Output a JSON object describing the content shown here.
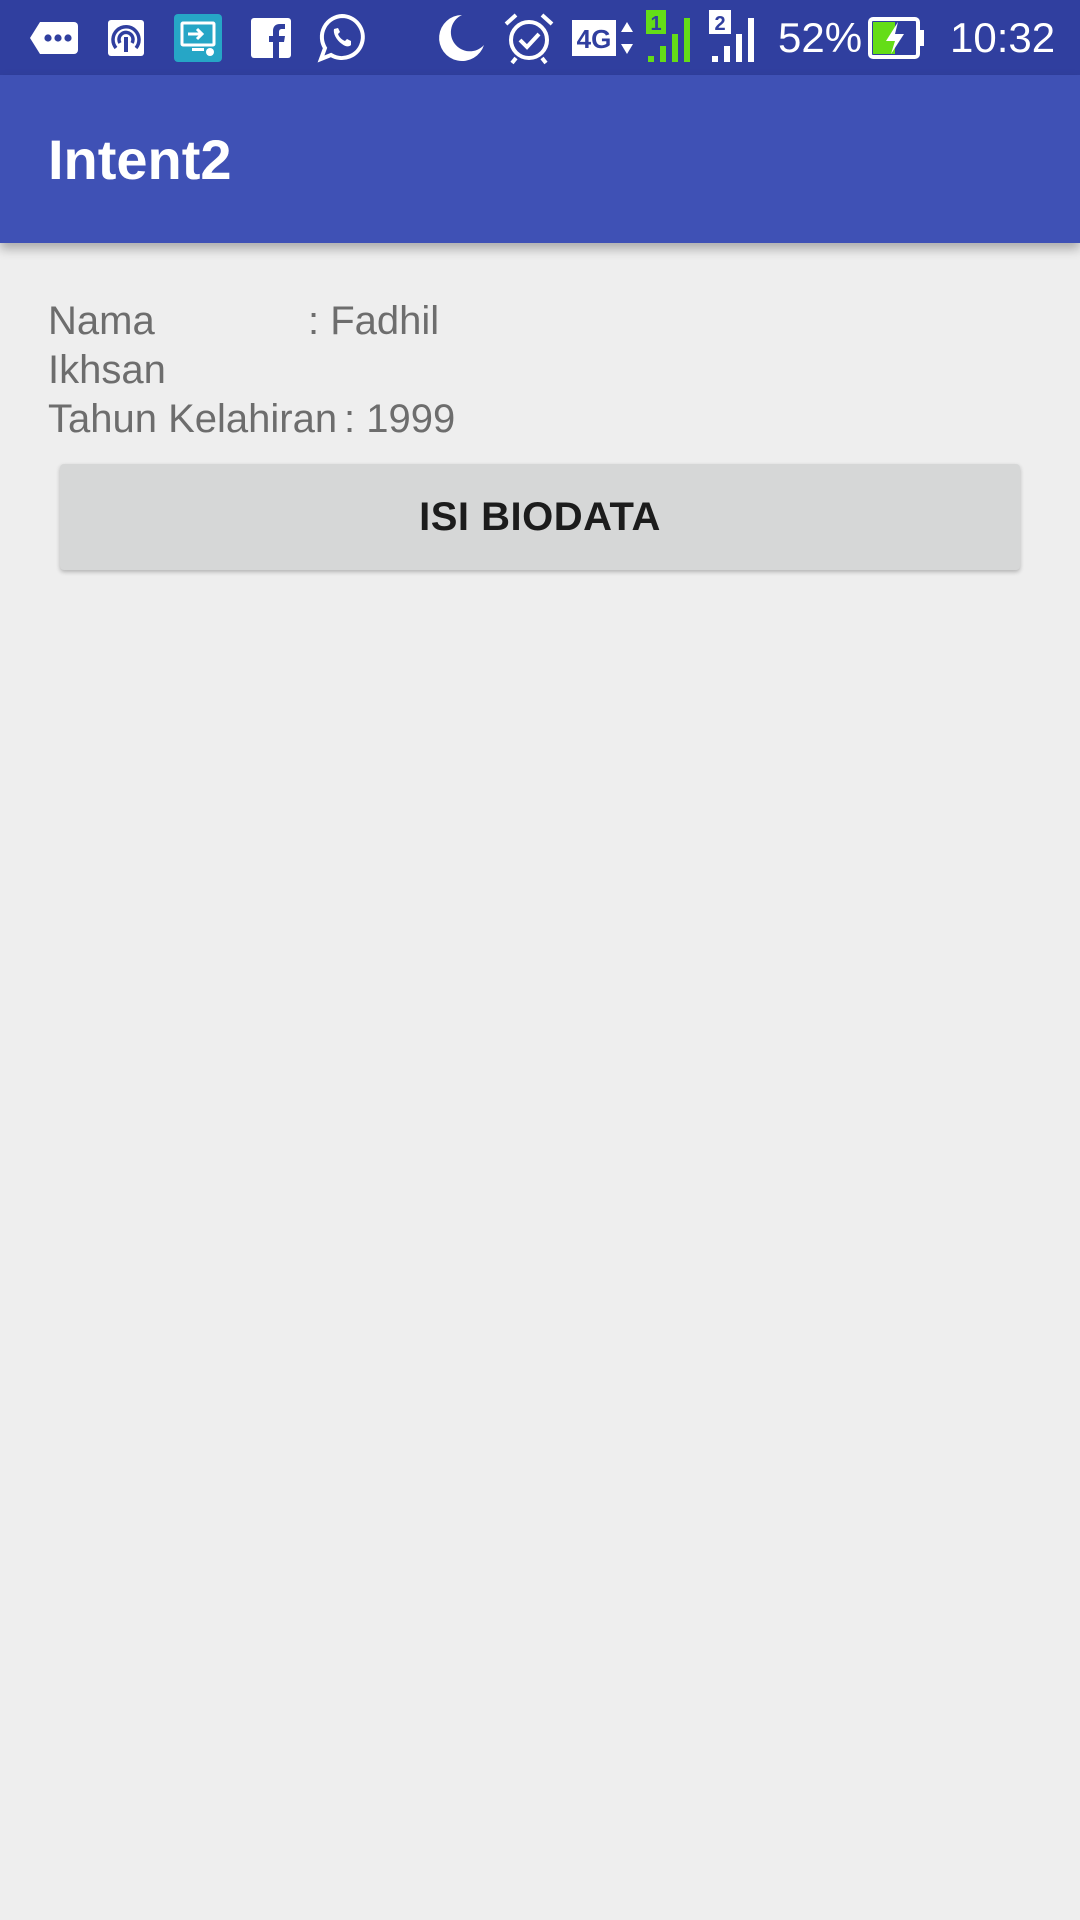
{
  "status_bar": {
    "icons": [
      "message-dots-icon",
      "hotspot-icon",
      "screen-share-icon",
      "facebook-icon",
      "whatsapp-icon",
      "moon-icon",
      "alarm-icon",
      "network-4g-icon",
      "sim1-signal-icon",
      "sim2-signal-icon",
      "battery-charging-icon"
    ],
    "network_type": "4G",
    "sim1_label": "1",
    "sim2_label": "2",
    "battery_percent": "52%",
    "battery_level": 0.52,
    "time": "10:32",
    "colors": {
      "background": "#303f9f",
      "sim1_signal": "#64dd17",
      "battery_fill": "#64dd17"
    }
  },
  "app_bar": {
    "title": "Intent2",
    "color": "#3f51b5"
  },
  "biodata": {
    "nama_label": "Nama",
    "nama_value": ": Fadhil",
    "nama_value_cont": "Ikhsan",
    "tahun_label": "Tahun Kelahiran",
    "tahun_value": ": 1999"
  },
  "actions": {
    "isi_biodata_label": "ISI BIODATA"
  }
}
